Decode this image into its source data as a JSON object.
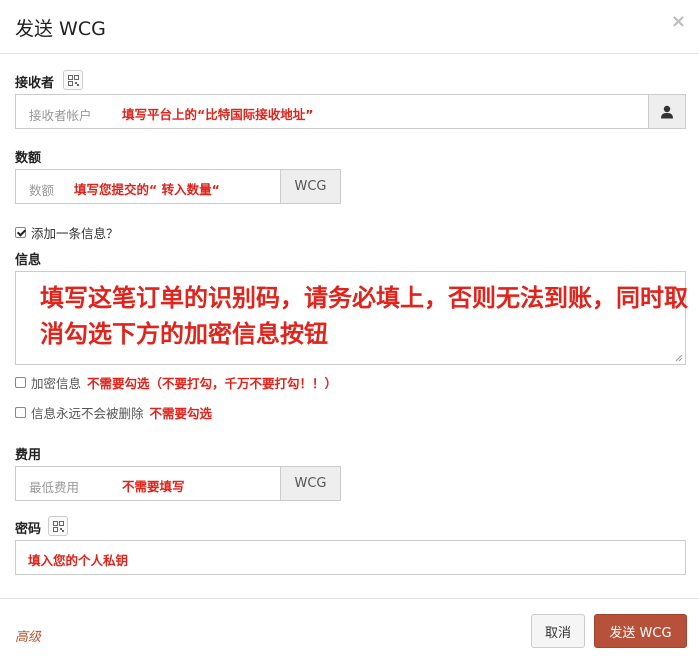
{
  "modal": {
    "title": "发送 WCG",
    "close_glyph": "×"
  },
  "recipient": {
    "label": "接收者",
    "placeholder": "接收者帐户",
    "hint": "填写平台上的“比特国际接收地址”",
    "addon_icon": "user-icon",
    "qr_icon": "qr-code-icon"
  },
  "amount": {
    "label": "数额",
    "placeholder": "数额",
    "hint": "填写您提交的“ 转入数量“",
    "unit": "WCG"
  },
  "add_message": {
    "label": "添加一条信息？",
    "checked": true
  },
  "message": {
    "label": "信息",
    "content": "填写这笔订单的识别码，请务必填上，否则无法到账，同时取消勾选下方的加密信息按钮"
  },
  "encrypt": {
    "label": "加密信息",
    "hint": "不需要勾选（不要打勾，千万不要打勾！！）",
    "checked": false
  },
  "permanent": {
    "label": "信息永远不会被删除",
    "hint": "不需要勾选",
    "checked": false
  },
  "fee": {
    "label": "费用",
    "placeholder": "最低费用",
    "hint": "不需要填写",
    "unit": "WCG"
  },
  "password": {
    "label": "密码",
    "hint": "填入您的个人私钥",
    "qr_icon": "qr-code-icon"
  },
  "footer": {
    "advanced": "高级",
    "cancel": "取消",
    "send": "发送 WCG"
  },
  "colors": {
    "accent": "#b7513a",
    "hint_red": "#e0231b",
    "advanced_link": "#b5522d"
  }
}
